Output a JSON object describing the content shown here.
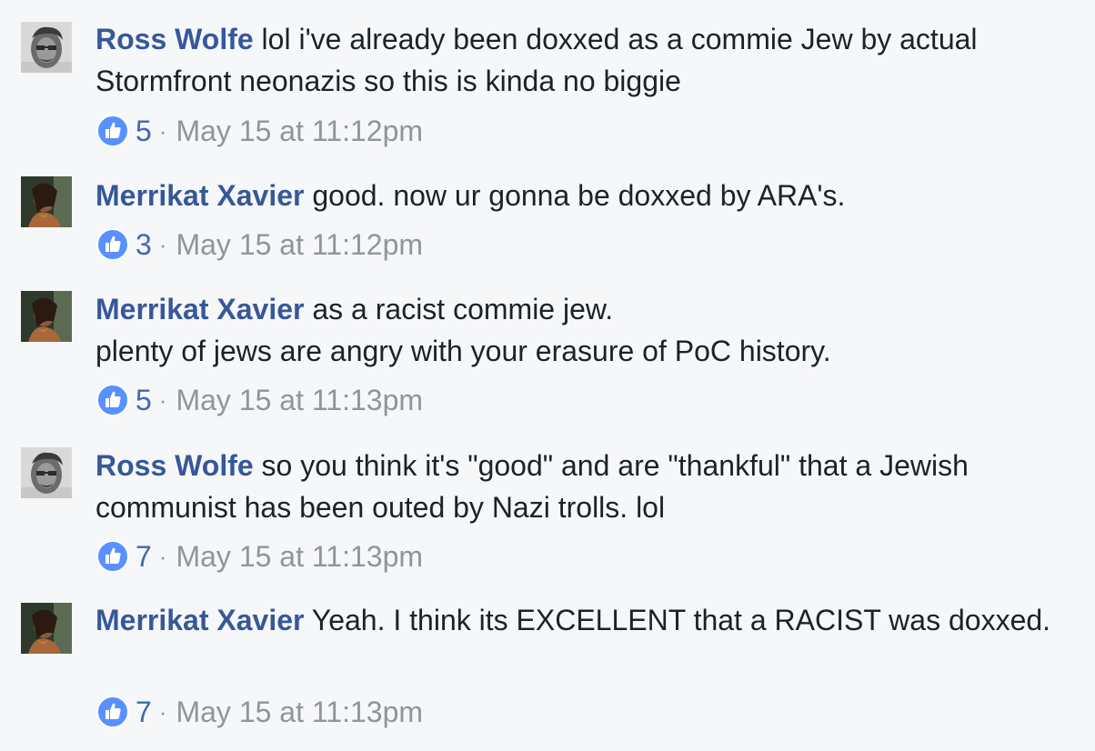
{
  "colors": {
    "background": "#f6f7f9",
    "author": "#365899",
    "text": "#1d2129",
    "meta": "#90949c",
    "like_blue": "#4267b2"
  },
  "icons": {
    "like": "thumbs-up-icon"
  },
  "comments": [
    {
      "author": "Ross Wolfe",
      "text": "lol i've already been doxxed as a commie Jew by actual Stormfront neonazis so this is kinda no biggie",
      "likes": "5",
      "separator": "·",
      "timestamp": "May 15 at 11:12pm",
      "avatar": "ross-wolfe-avatar"
    },
    {
      "author": "Merrikat Xavier",
      "text": "good. now ur gonna be doxxed by ARA's.",
      "likes": "3",
      "separator": "·",
      "timestamp": "May 15 at 11:12pm",
      "avatar": "merrikat-xavier-avatar"
    },
    {
      "author": "Merrikat Xavier",
      "text": "as a racist commie jew.\nplenty of jews are angry with your erasure of PoC history.",
      "likes": "5",
      "separator": "·",
      "timestamp": "May 15 at 11:13pm",
      "avatar": "merrikat-xavier-avatar"
    },
    {
      "author": "Ross Wolfe",
      "text": "so you think it's \"good\" and are \"thankful\" that a Jewish communist has been outed by Nazi trolls. lol",
      "likes": "7",
      "separator": "·",
      "timestamp": "May 15 at 11:13pm",
      "avatar": "ross-wolfe-avatar"
    },
    {
      "author": "Merrikat Xavier",
      "text": "Yeah. I think its EXCELLENT that a RACIST was doxxed.",
      "likes": "7",
      "separator": "·",
      "timestamp": "May 15 at 11:13pm",
      "avatar": "merrikat-xavier-avatar"
    }
  ]
}
